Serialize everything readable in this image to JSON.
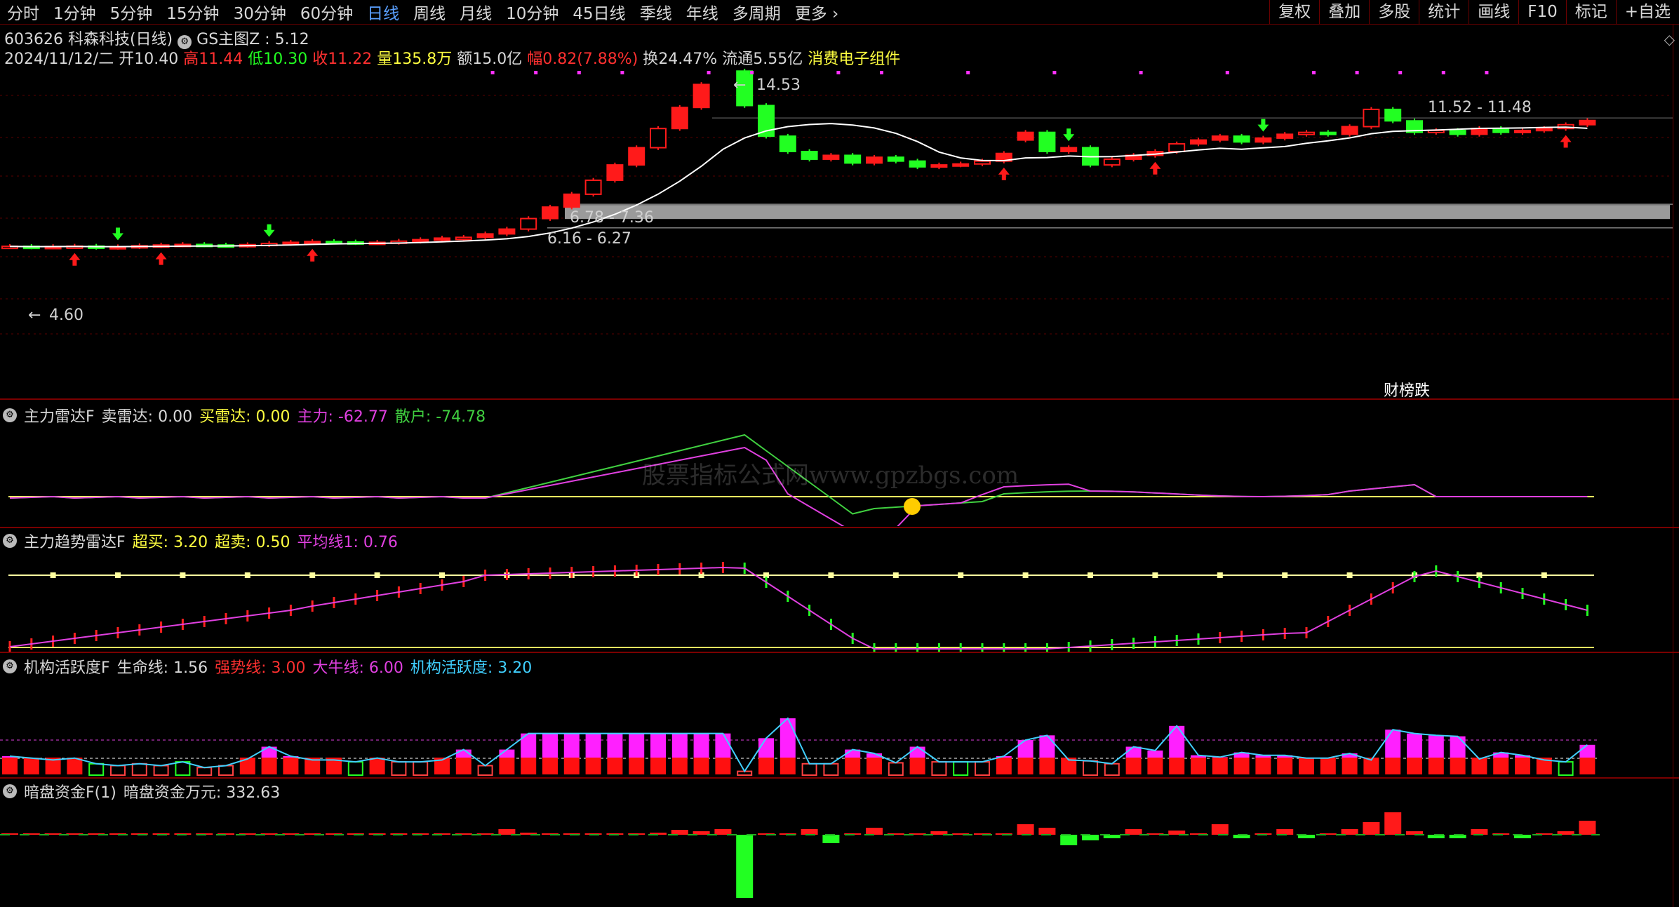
{
  "toolbar": {
    "periods": [
      "分时",
      "1分钟",
      "5分钟",
      "15分钟",
      "30分钟",
      "60分钟",
      "日线",
      "周线",
      "月线",
      "10分钟",
      "45日线",
      "季线",
      "年线",
      "多周期",
      "更多"
    ],
    "active": "日线",
    "more_chevron": "chevron-right-icon",
    "right_buttons": [
      "复权",
      "叠加",
      "多股",
      "统计",
      "画线",
      "F10",
      "标记",
      "+自选"
    ]
  },
  "stock": {
    "code_name": "603626 科森科技(日线)",
    "indicator": "GS主图Z",
    "indicator_value": ": 5.12",
    "date": "2024/11/12/二",
    "open_label": "开",
    "open": "10.40",
    "high_label": "高",
    "high": "11.44",
    "low_label": "低",
    "low": "10.30",
    "close_label": "收",
    "close": "11.22",
    "vol_label": "量",
    "vol": "135.8万",
    "amount_label": "额",
    "amount": "15.0亿",
    "chg_label": "幅",
    "chg": "0.82(7.88%)",
    "turnover_label": "换",
    "turnover": "24.47%",
    "float_label": "流通",
    "float": "5.55亿",
    "sector": "消费电子组件"
  },
  "main_chart": {
    "annotations": {
      "peak": "14.53",
      "low_mark": "4.60",
      "zone_high": "11.52 - 11.48",
      "zone_mid": "6.78 - 7.36",
      "zone_low": "6.16 - 6.27"
    },
    "badge": "财榜跌",
    "colors": {
      "up": "#ff1a1a",
      "down": "#22ff22",
      "ma": "#ffffff",
      "zone": "#9a9a9a"
    }
  },
  "ind1": {
    "name": "主力雷达F",
    "f1_label": "卖雷达:",
    "f1": "0.00",
    "f2_label": "买雷达:",
    "f2": "0.00",
    "f3_label": "主力:",
    "f3": "-62.77",
    "f4_label": "散户:",
    "f4": "-74.78"
  },
  "ind2": {
    "name": "主力趋势雷达F",
    "f1_label": "超买:",
    "f1": "3.20",
    "f2_label": "超卖:",
    "f2": "0.50",
    "f3_label": "平均线1:",
    "f3": "0.76"
  },
  "ind3": {
    "name": "机构活跃度F",
    "f1_label": "生命线:",
    "f1": "1.56",
    "f2_label": "强势线:",
    "f2": "3.00",
    "f3_label": "大牛线:",
    "f3": "6.00",
    "f4_label": "机构活跃度:",
    "f4": "3.20"
  },
  "ind4": {
    "name": "暗盘资金F(1)",
    "f1_label": "暗盘资金万元:",
    "f1": "332.63"
  },
  "watermark": "股票指标公式网www.gpzbgs.com",
  "right_marker": "◇"
}
